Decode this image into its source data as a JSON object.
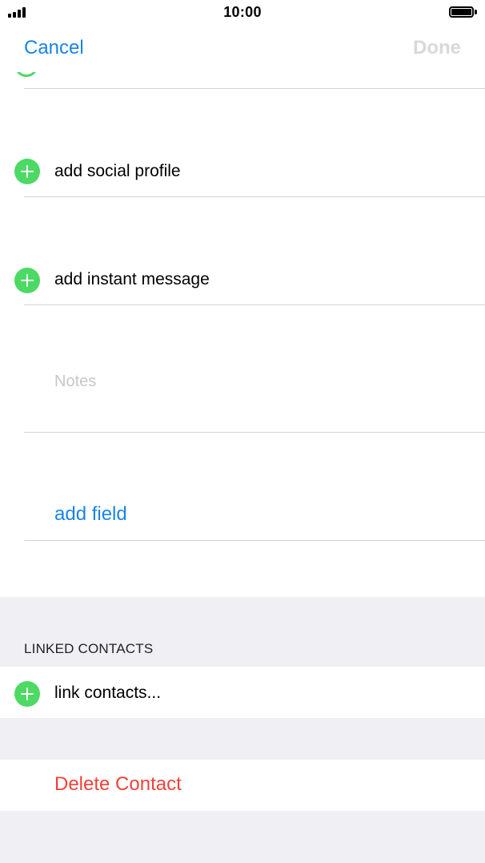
{
  "status_bar": {
    "time": "10:00"
  },
  "nav": {
    "cancel_label": "Cancel",
    "done_label": "Done"
  },
  "rows": {
    "social_profile": "add social profile",
    "instant_message": "add instant message",
    "notes_placeholder": "Notes",
    "add_field": "add field"
  },
  "linked_contacts": {
    "header": "LINKED CONTACTS",
    "link_label": "link contacts..."
  },
  "delete": {
    "label": "Delete Contact"
  },
  "colors": {
    "accent_blue": "#1a83e6",
    "add_green": "#4cd964",
    "destructive_red": "#f0413a",
    "disabled_gray": "#d9d9d9",
    "group_background": "#efeff4"
  }
}
